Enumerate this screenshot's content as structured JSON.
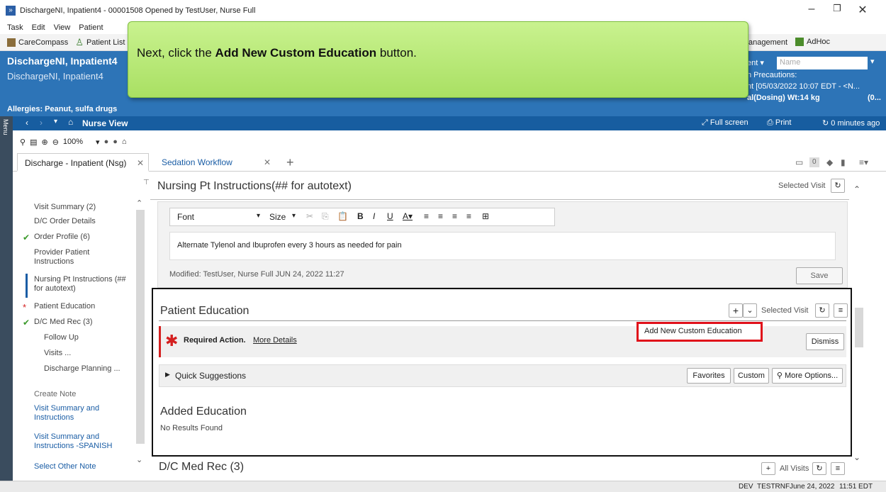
{
  "window": {
    "title": "DischargeNI, Inpatient4 - 00001508 Opened by TestUser, Nurse Full",
    "minimize": "–",
    "maximize": "❐",
    "close": "✕"
  },
  "menu": [
    "Task",
    "Edit",
    "View",
    "Patient"
  ],
  "toolbar": {
    "carecompass": "CareCompass",
    "patient_list": "Patient List",
    "management": "anagement",
    "adhoc": "AdHoc"
  },
  "banner": {
    "patient_name": "DischargeNI, Inpatient4",
    "patient_name_sub": "DischargeNI, Inpatient4",
    "allergies": "Allergies: Peanut, sulfa drugs",
    "search_scope": "ent ▾",
    "search_placeholder": "Name",
    "precautions": "n Precautions:",
    "admit": "nt [05/03/2022 10:07 EDT - <N...",
    "dosing": "al(Dosing) Wt:14 kg",
    "dosing_extra": "(0..."
  },
  "navbar": {
    "title": "Nurse View",
    "full_screen": "Full screen",
    "print": "Print",
    "refresh": "0 minutes ago"
  },
  "zoom": "100%",
  "tabs": {
    "tab1": "Discharge - Inpatient (Nsg)",
    "tab2": "Sedation Workflow",
    "badge_count": "0"
  },
  "sidebar": {
    "items": [
      "Visit Summary (2)",
      "D/C Order Details",
      "Order Profile (6)",
      "Provider Patient Instructions",
      "Nursing Pt Instructions (## for autotext)",
      "Patient Education",
      "D/C Med Rec (3)",
      "Follow Up",
      "Visits ...",
      "Discharge Planning ..."
    ],
    "create_note_header": "Create Note",
    "notes": [
      "Visit Summary and Instructions",
      "Visit Summary and Instructions -SPANISH",
      "Select Other Note"
    ]
  },
  "nursing": {
    "heading": "Nursing Pt Instructions(## for autotext)",
    "selected_visit": "Selected Visit",
    "font_label": "Font",
    "size_label": "Size",
    "text": "Alternate Tylenol and Ibuprofen every 3 hours as needed for pain",
    "modified": "Modified: TestUser, Nurse Full JUN 24, 2022 11:27",
    "save": "Save"
  },
  "education": {
    "heading": "Patient Education",
    "selected_visit": "Selected Visit",
    "required_action": "Required Action.",
    "more_details": "More Details",
    "add_custom": "Add New Custom Education",
    "dismiss": "Dismiss",
    "quick_suggestions": "Quick Suggestions",
    "favorites": "Favorites",
    "custom": "Custom",
    "more_options": "More Options...",
    "added_heading": "Added Education",
    "no_results": "No Results Found"
  },
  "medrec": {
    "heading": "D/C Med Rec (3)",
    "all_visits": "All Visits"
  },
  "tooltip": {
    "prefix": "Next, click the ",
    "bold": "Add New Custom Education",
    "suffix": " button."
  },
  "status": {
    "env": "DEV",
    "user": "TESTRNF",
    "date": "June 24, 2022",
    "time": "11:51 EDT"
  },
  "colors": {
    "banner": "#2d74b7",
    "navbar": "#175da0",
    "tooltip": "#b5e873",
    "highlight": "#e0101a",
    "required": "#d42020"
  }
}
